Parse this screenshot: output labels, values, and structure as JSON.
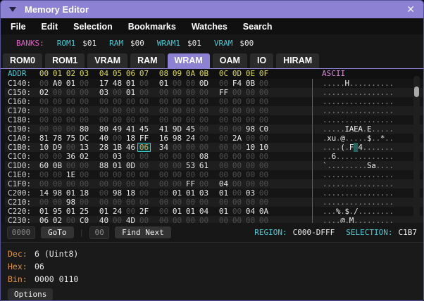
{
  "window": {
    "title": "Memory Editor",
    "collapse_icon": "triangle-down",
    "close_icon": "✕"
  },
  "menu": {
    "items": [
      "File",
      "Edit",
      "Selection",
      "Bookmarks",
      "Watches",
      "Search"
    ]
  },
  "banks": {
    "label": "BANKS:",
    "entries": [
      {
        "name": "ROM1",
        "value": "$01"
      },
      {
        "name": "RAM",
        "value": "$00"
      },
      {
        "name": "WRAM1",
        "value": "$01"
      },
      {
        "name": "VRAM",
        "value": "$00"
      }
    ]
  },
  "tabs": {
    "items": [
      "ROM0",
      "ROM1",
      "VRAM",
      "RAM",
      "WRAM",
      "OAM",
      "IO",
      "HIRAM"
    ],
    "active": "WRAM"
  },
  "hex": {
    "addr_header": "ADDR",
    "ascii_header": "ASCII",
    "offsets": [
      "00",
      "01",
      "02",
      "03",
      "04",
      "05",
      "06",
      "07",
      "08",
      "09",
      "0A",
      "0B",
      "0C",
      "0D",
      "0E",
      "0F"
    ],
    "selection": {
      "row_index": 7,
      "byte_index": 7
    },
    "rows": [
      {
        "addr": "C140:",
        "bytes": [
          "00",
          "A0",
          "01",
          "00",
          "17",
          "48",
          "01",
          "00",
          "01",
          "00",
          "00",
          "0D",
          "00",
          "F4",
          "0B",
          "00"
        ],
        "ascii": ".....H.........."
      },
      {
        "addr": "C150:",
        "bytes": [
          "02",
          "00",
          "00",
          "00",
          "03",
          "00",
          "01",
          "00",
          "00",
          "00",
          "00",
          "00",
          "FF",
          "00",
          "00",
          "00"
        ],
        "ascii": "................"
      },
      {
        "addr": "C160:",
        "bytes": [
          "00",
          "00",
          "00",
          "00",
          "00",
          "00",
          "00",
          "00",
          "00",
          "00",
          "00",
          "00",
          "00",
          "00",
          "00",
          "00"
        ],
        "ascii": "................"
      },
      {
        "addr": "C170:",
        "bytes": [
          "00",
          "00",
          "00",
          "00",
          "00",
          "00",
          "00",
          "00",
          "00",
          "00",
          "00",
          "00",
          "00",
          "00",
          "00",
          "00"
        ],
        "ascii": "................"
      },
      {
        "addr": "C180:",
        "bytes": [
          "00",
          "00",
          "00",
          "00",
          "00",
          "00",
          "00",
          "00",
          "00",
          "00",
          "00",
          "00",
          "00",
          "00",
          "00",
          "00"
        ],
        "ascii": "................"
      },
      {
        "addr": "C190:",
        "bytes": [
          "00",
          "00",
          "00",
          "80",
          "80",
          "49",
          "41",
          "45",
          "41",
          "9D",
          "45",
          "00",
          "00",
          "00",
          "98",
          "C0"
        ],
        "ascii": ".....IAEA.E....."
      },
      {
        "addr": "C1A0:",
        "bytes": [
          "81",
          "78",
          "75",
          "DC",
          "40",
          "00",
          "18",
          "FF",
          "16",
          "98",
          "24",
          "00",
          "00",
          "2A",
          "00",
          "00"
        ],
        "ascii": ".xu.@.....$..*.."
      },
      {
        "addr": "C1B0:",
        "bytes": [
          "10",
          "D9",
          "00",
          "13",
          "28",
          "1B",
          "46",
          "06",
          "34",
          "00",
          "00",
          "00",
          "00",
          "00",
          "10",
          "10"
        ],
        "ascii": "....(.F.4......."
      },
      {
        "addr": "C1C0:",
        "bytes": [
          "00",
          "00",
          "36",
          "02",
          "00",
          "03",
          "00",
          "00",
          "00",
          "00",
          "00",
          "08",
          "00",
          "00",
          "00",
          "00"
        ],
        "ascii": "..6............."
      },
      {
        "addr": "C1D0:",
        "bytes": [
          "60",
          "0B",
          "00",
          "00",
          "88",
          "01",
          "0D",
          "00",
          "00",
          "00",
          "53",
          "61",
          "00",
          "00",
          "00",
          "00"
        ],
        "ascii": "`.........Sa...."
      },
      {
        "addr": "C1E0:",
        "bytes": [
          "00",
          "00",
          "1E",
          "00",
          "00",
          "00",
          "00",
          "00",
          "00",
          "00",
          "00",
          "00",
          "00",
          "00",
          "00",
          "00"
        ],
        "ascii": "................"
      },
      {
        "addr": "C1F0:",
        "bytes": [
          "00",
          "00",
          "00",
          "00",
          "00",
          "00",
          "00",
          "00",
          "00",
          "00",
          "FF",
          "00",
          "04",
          "00",
          "00",
          "00"
        ],
        "ascii": "................"
      },
      {
        "addr": "C200:",
        "bytes": [
          "14",
          "98",
          "01",
          "18",
          "00",
          "98",
          "18",
          "00",
          "00",
          "01",
          "01",
          "03",
          "01",
          "00",
          "03",
          "00"
        ],
        "ascii": "................"
      },
      {
        "addr": "C210:",
        "bytes": [
          "00",
          "00",
          "98",
          "00",
          "00",
          "00",
          "00",
          "00",
          "00",
          "00",
          "00",
          "00",
          "00",
          "00",
          "00",
          "00"
        ],
        "ascii": "................"
      },
      {
        "addr": "C220:",
        "bytes": [
          "01",
          "95",
          "01",
          "25",
          "01",
          "24",
          "00",
          "2F",
          "00",
          "01",
          "01",
          "04",
          "01",
          "00",
          "04",
          "0A"
        ],
        "ascii": "...%.$./........"
      },
      {
        "addr": "C230:",
        "bytes": [
          "06",
          "02",
          "00",
          "C0",
          "40",
          "00",
          "4D",
          "00",
          "00",
          "00",
          "00",
          "00",
          "00",
          "00",
          "00",
          "00"
        ],
        "ascii": "....@.M........."
      }
    ]
  },
  "footer": {
    "goto_value": "0000",
    "goto_button": "GoTo",
    "separator": "|",
    "find_value": "00",
    "find_button": "Find Next",
    "region_label": "REGION:",
    "region_value": "C000-DFFF",
    "selection_label": "SELECTION:",
    "selection_value": "C1B7"
  },
  "inspector": {
    "dec_label": "Dec:",
    "dec_value": "6 (Uint8)",
    "hex_label": "Hex:",
    "hex_value": "06",
    "bin_label": "Bin:",
    "bin_value": "0000 0110",
    "options_button": "Options"
  },
  "colors": {
    "titlebar": "#8C81D2",
    "active_tab": "#8C81D2",
    "cyan": "#4CC8D4",
    "offset_yellow": "#D9D955",
    "pink": "#E25FC8",
    "orange": "#E09440",
    "selection_teal": "#35C9C9",
    "zero_byte": "#4E4E4E"
  }
}
